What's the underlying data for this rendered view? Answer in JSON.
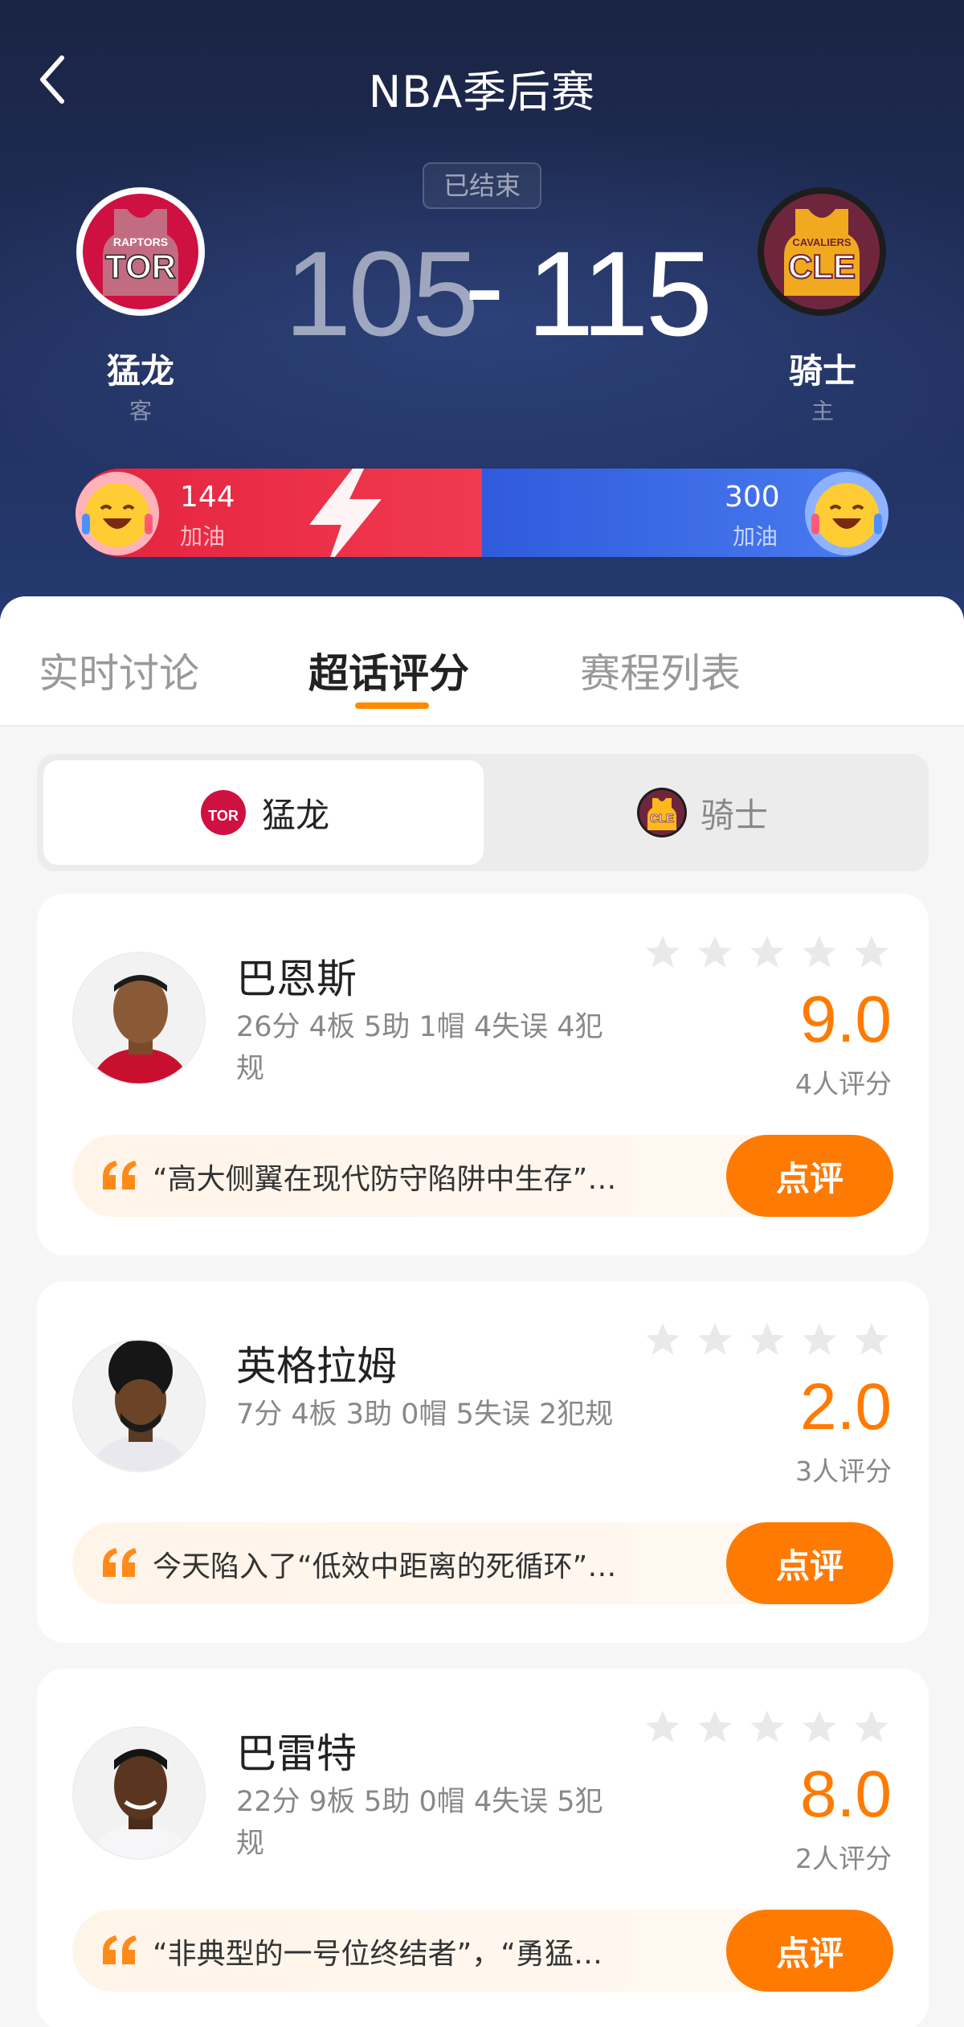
{
  "header": {
    "title": "NBA季后赛",
    "status": "已结束"
  },
  "teams": {
    "away": {
      "name": "猛龙",
      "role": "客",
      "score": "105",
      "abbr": "TOR",
      "logo_text": "RAPTORS",
      "color": "#ce1141"
    },
    "home": {
      "name": "骑士",
      "role": "主",
      "score": "115",
      "abbr": "CLE",
      "logo_text": "CAVALIERS",
      "color": "#6f263d"
    },
    "separator": "-"
  },
  "cheer": {
    "away": {
      "count": "144",
      "label": "加油"
    },
    "home": {
      "count": "300",
      "label": "加油"
    }
  },
  "tabs": [
    {
      "label": "实时讨论"
    },
    {
      "label": "超话评分"
    },
    {
      "label": "赛程列表"
    }
  ],
  "active_tab": "超话评分",
  "team_switch": {
    "away_label": "猛龙",
    "home_label": "骑士"
  },
  "players": [
    {
      "name": "巴恩斯",
      "stats": "26分 4板 5助 1帽 4失误 4犯规",
      "score": "9.0",
      "raters": "4人评分",
      "quote": "“高大侧翼在现代防守陷阱中生存”的…",
      "button": "点评"
    },
    {
      "name": "英格拉姆",
      "stats": "7分 4板 3助 0帽 5失误 2犯规",
      "score": "2.0",
      "raters": "3人评分",
      "quote": "今天陷入了“低效中距离的死循环”，“…",
      "button": "点评"
    },
    {
      "name": "巴雷特",
      "stats": "22分 9板 5助 0帽 4失误 5犯规",
      "score": "8.0",
      "raters": "2人评分",
      "quote": "“非典型的一号位终结者”，“勇猛有余…",
      "button": "点评"
    }
  ],
  "colors": {
    "accent": "#ff7a00",
    "cheer_red": "#e4233f",
    "cheer_blue": "#2f5bdc",
    "header_bg": "#1f2d57"
  }
}
